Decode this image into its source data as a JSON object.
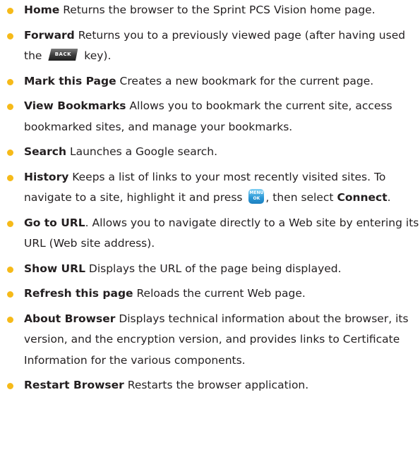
{
  "colors": {
    "bullet": "#f6ba19",
    "text": "#231f20",
    "menu_key": "#2a98d6",
    "back_key": "#3c3c3c"
  },
  "items": [
    {
      "term": "Home",
      "text": " Returns the browser to the Sprint PCS Vision home page."
    },
    {
      "term": "Forward",
      "text_before": " Returns you to a previously viewed page (after having used the ",
      "key": "BACK",
      "key_icon": "back-key-icon",
      "text_after": " key)."
    },
    {
      "term": "Mark this Page",
      "text": " Creates a new bookmark for the current page."
    },
    {
      "term": "View Bookmarks",
      "text": " Allows you to bookmark the current site, access bookmarked sites, and manage your bookmarks."
    },
    {
      "term": "Search",
      "text": " Launches a Google search."
    },
    {
      "term": "History",
      "text_before": " Keeps a list of links to your most recently visited sites. To navigate to a site, highlight it and press ",
      "key_top": "MENU",
      "key_bottom": "OK",
      "key_icon": "menu-ok-key-icon",
      "text_after": ", then select ",
      "term2": "Connect",
      "text_end": "."
    },
    {
      "term": "Go to URL",
      "text": ". Allows you to navigate directly to a Web site by entering its URL (Web site address)."
    },
    {
      "term": "Show URL",
      "text": " Displays the URL of the page being displayed."
    },
    {
      "term": "Refresh this page",
      "text": " Reloads the current Web page."
    },
    {
      "term": "About Browser",
      "text": " Displays technical information about the browser, its version, and the encryption version, and provides links to Certificate Information for the various components."
    },
    {
      "term": "Restart Browser",
      "text": " Restarts the browser application."
    }
  ]
}
